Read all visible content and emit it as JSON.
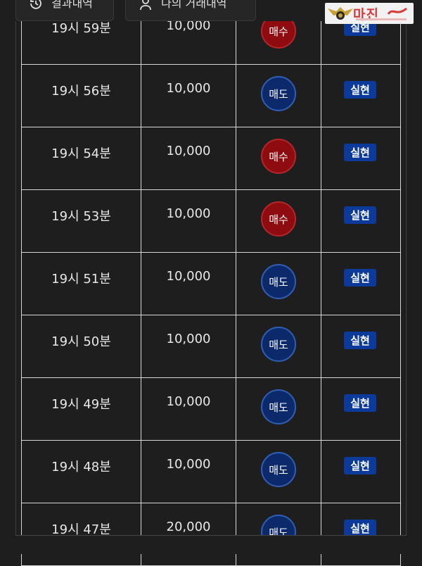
{
  "tabs": {
    "results_label": "결과내역",
    "my_trades_label": "나의 거래내역"
  },
  "logo": {
    "text": "마진"
  },
  "rows": [
    {
      "time": "19시 59분",
      "amount": "10,000",
      "side": "매수",
      "side_type": "buy",
      "status": "실현"
    },
    {
      "time": "19시 56분",
      "amount": "10,000",
      "side": "매도",
      "side_type": "sell",
      "status": "실현"
    },
    {
      "time": "19시 54분",
      "amount": "10,000",
      "side": "매수",
      "side_type": "buy",
      "status": "실현"
    },
    {
      "time": "19시 53분",
      "amount": "10,000",
      "side": "매수",
      "side_type": "buy",
      "status": "실현"
    },
    {
      "time": "19시 51분",
      "amount": "10,000",
      "side": "매도",
      "side_type": "sell",
      "status": "실현"
    },
    {
      "time": "19시 50분",
      "amount": "10,000",
      "side": "매도",
      "side_type": "sell",
      "status": "실현"
    },
    {
      "time": "19시 49분",
      "amount": "10,000",
      "side": "매도",
      "side_type": "sell",
      "status": "실현"
    },
    {
      "time": "19시 48분",
      "amount": "10,000",
      "side": "매도",
      "side_type": "sell",
      "status": "실현"
    },
    {
      "time": "19시 47분",
      "amount": "20,000",
      "side": "매도",
      "side_type": "sell",
      "status": "실현"
    }
  ],
  "colors": {
    "buy": "#8e0b10",
    "sell": "#0c2a6b",
    "status": "#0b3a9a",
    "background": "#1e1e1e"
  }
}
